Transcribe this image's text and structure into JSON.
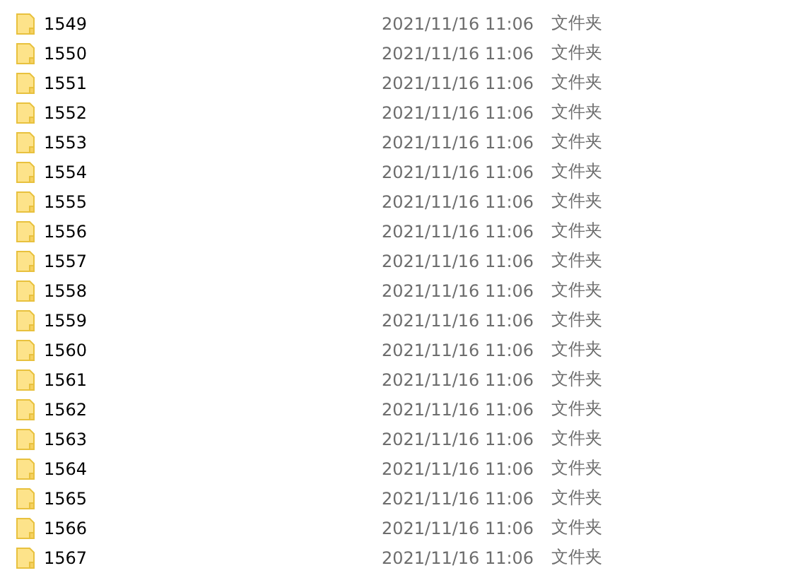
{
  "files": [
    {
      "name": "1549",
      "modified": "2021/11/16 11:06",
      "type": "文件夹"
    },
    {
      "name": "1550",
      "modified": "2021/11/16 11:06",
      "type": "文件夹"
    },
    {
      "name": "1551",
      "modified": "2021/11/16 11:06",
      "type": "文件夹"
    },
    {
      "name": "1552",
      "modified": "2021/11/16 11:06",
      "type": "文件夹"
    },
    {
      "name": "1553",
      "modified": "2021/11/16 11:06",
      "type": "文件夹"
    },
    {
      "name": "1554",
      "modified": "2021/11/16 11:06",
      "type": "文件夹"
    },
    {
      "name": "1555",
      "modified": "2021/11/16 11:06",
      "type": "文件夹"
    },
    {
      "name": "1556",
      "modified": "2021/11/16 11:06",
      "type": "文件夹"
    },
    {
      "name": "1557",
      "modified": "2021/11/16 11:06",
      "type": "文件夹"
    },
    {
      "name": "1558",
      "modified": "2021/11/16 11:06",
      "type": "文件夹"
    },
    {
      "name": "1559",
      "modified": "2021/11/16 11:06",
      "type": "文件夹"
    },
    {
      "name": "1560",
      "modified": "2021/11/16 11:06",
      "type": "文件夹"
    },
    {
      "name": "1561",
      "modified": "2021/11/16 11:06",
      "type": "文件夹"
    },
    {
      "name": "1562",
      "modified": "2021/11/16 11:06",
      "type": "文件夹"
    },
    {
      "name": "1563",
      "modified": "2021/11/16 11:06",
      "type": "文件夹"
    },
    {
      "name": "1564",
      "modified": "2021/11/16 11:06",
      "type": "文件夹"
    },
    {
      "name": "1565",
      "modified": "2021/11/16 11:06",
      "type": "文件夹"
    },
    {
      "name": "1566",
      "modified": "2021/11/16 11:06",
      "type": "文件夹"
    },
    {
      "name": "1567",
      "modified": "2021/11/16 11:06",
      "type": "文件夹"
    }
  ]
}
